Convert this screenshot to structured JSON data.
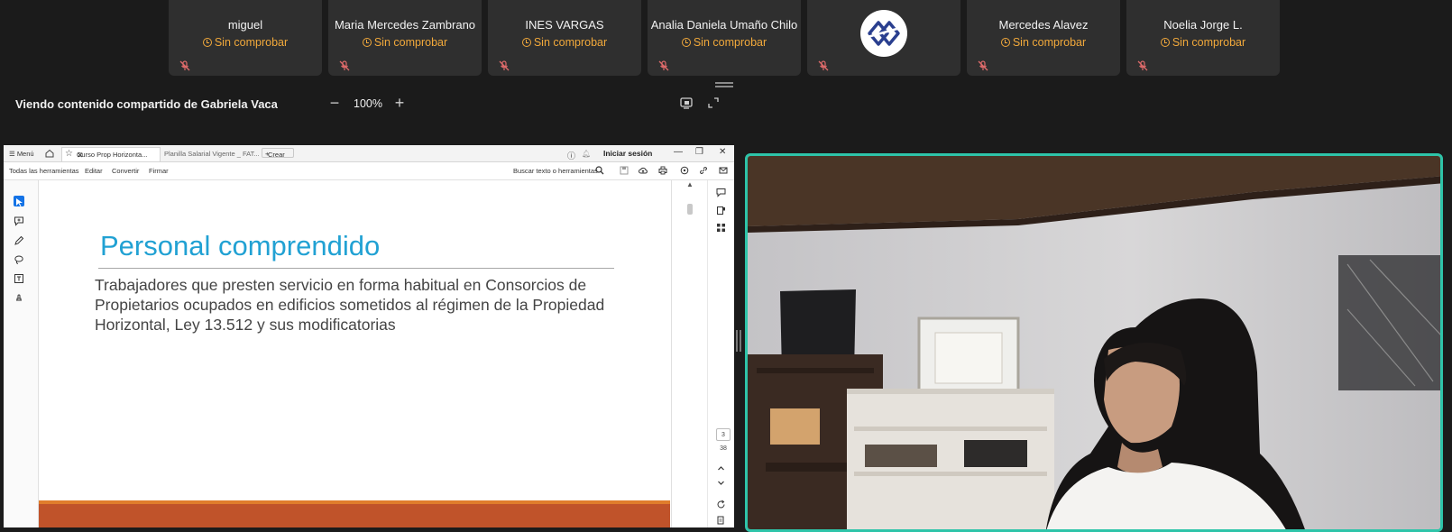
{
  "participants": [
    {
      "name": "miguel",
      "status": "Sin comprobar",
      "mic_icon": "mic-off-icon"
    },
    {
      "name": "Maria Mercedes Zambrano",
      "status": "Sin comprobar",
      "mic_icon": "mic-off-icon"
    },
    {
      "name": "INES VARGAS",
      "status": "Sin comprobar",
      "mic_icon": "mic-off-icon"
    },
    {
      "name": "Analia Daniela Umaño Chilo",
      "status": "Sin comprobar",
      "mic_icon": "mic-off-icon"
    },
    {
      "name": "",
      "status": "",
      "avatar": "org-logo",
      "mic_icon": "mic-off-icon"
    },
    {
      "name": "Mercedes Alavez",
      "status": "Sin comprobar",
      "mic_icon": "mic-off-icon"
    },
    {
      "name": "Noelia Jorge L.",
      "status": "Sin comprobar",
      "mic_icon": "mic-off-icon"
    }
  ],
  "share_bar": {
    "label": "Viendo contenido compartido de Gabriela Vaca",
    "zoom_minus": "−",
    "zoom": "100%",
    "zoom_plus": "+"
  },
  "shared_app": {
    "menu": "Menú",
    "tab_active": "Curso Prop Horizonta...",
    "tab_inactive": "Planilla Salarial Vigente _ FAT...",
    "new_tab": "Crear",
    "login": "Iniciar sesión",
    "toolbar": {
      "all_tools": "Todas las herramientas",
      "edit": "Editar",
      "convert": "Convertir",
      "sign": "Firmar",
      "search": "Buscar texto o herramientas"
    },
    "page_current": "3",
    "page_total": "38"
  },
  "slide": {
    "title": "Personal comprendido",
    "body": "Trabajadores que presten servicio en forma habitual en Consorcios de Propietarios ocupados en edificios sometidos al régimen de la Propiedad Horizontal, Ley 13.512 y sus modificatorias"
  },
  "colors": {
    "background": "#1b1b1b",
    "tile": "#2f2f2f",
    "status": "#f2a93b",
    "mic_off": "#e06b6b",
    "speaker_border": "#2ec4a9",
    "slide_title": "#21a1d3",
    "slide_band": "#c0532a"
  }
}
